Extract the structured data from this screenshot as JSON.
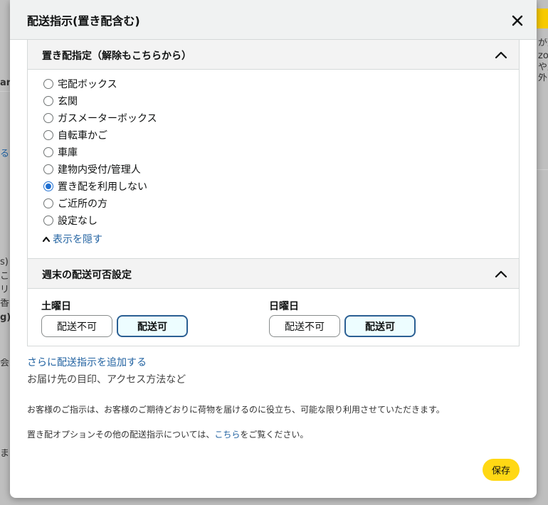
{
  "modal": {
    "title": "配送指示(置き配含む)",
    "close_icon": "close-icon"
  },
  "safe_place": {
    "title": "置き配指定（解除もこちらから）",
    "options": [
      {
        "label": "宅配ボックス",
        "checked": false
      },
      {
        "label": "玄関",
        "checked": false
      },
      {
        "label": "ガスメーターボックス",
        "checked": false
      },
      {
        "label": "自転車かご",
        "checked": false
      },
      {
        "label": "車庫",
        "checked": false
      },
      {
        "label": "建物内受付/管理人",
        "checked": false
      },
      {
        "label": "置き配を利用しない",
        "checked": true
      },
      {
        "label": "ご近所の方",
        "checked": false
      },
      {
        "label": "設定なし",
        "checked": false
      }
    ],
    "toggle_label": "表示を隠す"
  },
  "weekend": {
    "title": "週末の配送可否設定",
    "saturday": {
      "label": "土曜日",
      "no_label": "配送不可",
      "yes_label": "配送可",
      "selected": "yes"
    },
    "sunday": {
      "label": "日曜日",
      "no_label": "配送不可",
      "yes_label": "配送可",
      "selected": "yes"
    }
  },
  "additional": {
    "link": "さらに配送指示を追加する",
    "sub": "お届け先の目印、アクセス方法など"
  },
  "notes": {
    "line1": "お客様のご指示は、お客様のご期待どおりに荷物を届けるのに役立ち、可能な限り利用させていただきます。",
    "line2_pre": "置き配オプションその他の配送指示については、",
    "line2_link": "こちら",
    "line2_post": "をご覧ください。"
  },
  "save_label": "保存",
  "colors": {
    "link": "#2162a1",
    "radio_checked": "#1f6fd1",
    "save_button": "#ffd814",
    "selected_border": "#2b5f93"
  },
  "background_fragments": [
    "が外",
    "zon",
    "や及",
    "外国",
    "ar",
    "る",
    "s)",
    "こ",
    "リ",
    "香",
    "g)",
    "会",
    "ま"
  ]
}
